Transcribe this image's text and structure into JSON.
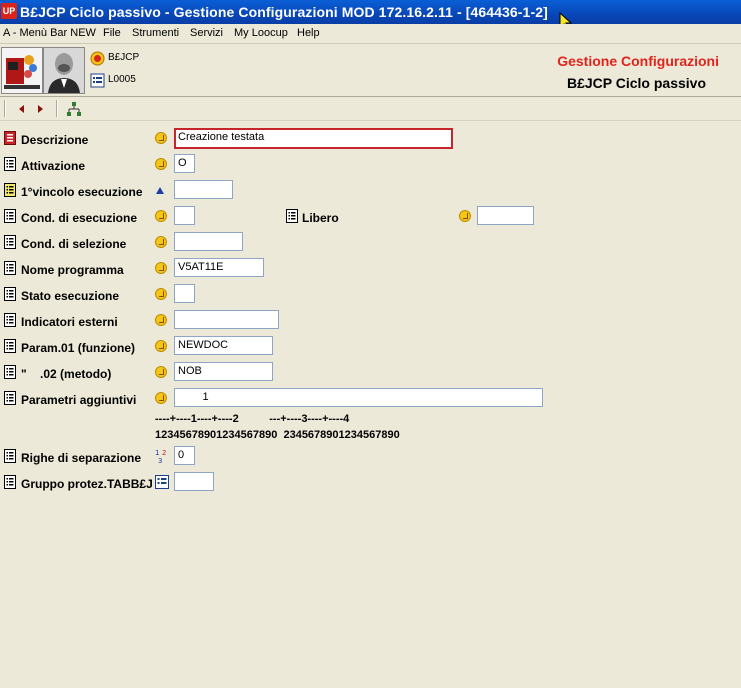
{
  "window": {
    "app_icon_text": "UP",
    "title": "B£JCP Ciclo passivo - Gestione Configurazioni MOD 172.16.2.11 - [464436-1-2]"
  },
  "menu": [
    "A - Menù Bar NEW",
    "File",
    "Strumenti",
    "Servizi",
    "My Loocup",
    "Help"
  ],
  "header": {
    "object_code": "B£JCP",
    "list_code": "L0005",
    "title": "Gestione Configurazioni",
    "subtitle": "B£JCP Ciclo passivo"
  },
  "form": {
    "descrizione": {
      "label": "Descrizione",
      "value": "Creazione testata"
    },
    "attivazione": {
      "label": "Attivazione",
      "value": "O"
    },
    "vincolo": {
      "label": "1°vincolo esecuzione",
      "value": ""
    },
    "cond_esecuzione": {
      "label": "Cond. di esecuzione",
      "value": ""
    },
    "libero": {
      "label": "Libero",
      "value": ""
    },
    "cond_selezione": {
      "label": "Cond. di selezione",
      "value": ""
    },
    "nome_programma": {
      "label": "Nome programma",
      "value": "V5AT11E"
    },
    "stato_esecuzione": {
      "label": "Stato esecuzione",
      "value": ""
    },
    "indicatori_esterni": {
      "label": "Indicatori esterni",
      "value": ""
    },
    "param01": {
      "label": "Param.01 (funzione)",
      "value": "NEWDOC"
    },
    "param02": {
      "label": "\"    .02 (metodo)",
      "value": "NOB"
    },
    "parametri_aggiuntivi": {
      "label": "Parametri aggiuntivi",
      "value": "        1"
    },
    "ruler_line1": "----+----1----+----2          ---+----3----+----4",
    "ruler_line2": "12345678901234567890  2345678901234567890",
    "righe_separazione": {
      "label": "Righe di separazione",
      "value": "0"
    },
    "gruppo_protez": {
      "label": "Gruppo protez.TABB£J",
      "value": ""
    }
  },
  "colors": {
    "titlebar": "#0a5fd6",
    "header_title": "#e0241d",
    "focus_border": "#c8242b",
    "background": "#ece9d8"
  }
}
